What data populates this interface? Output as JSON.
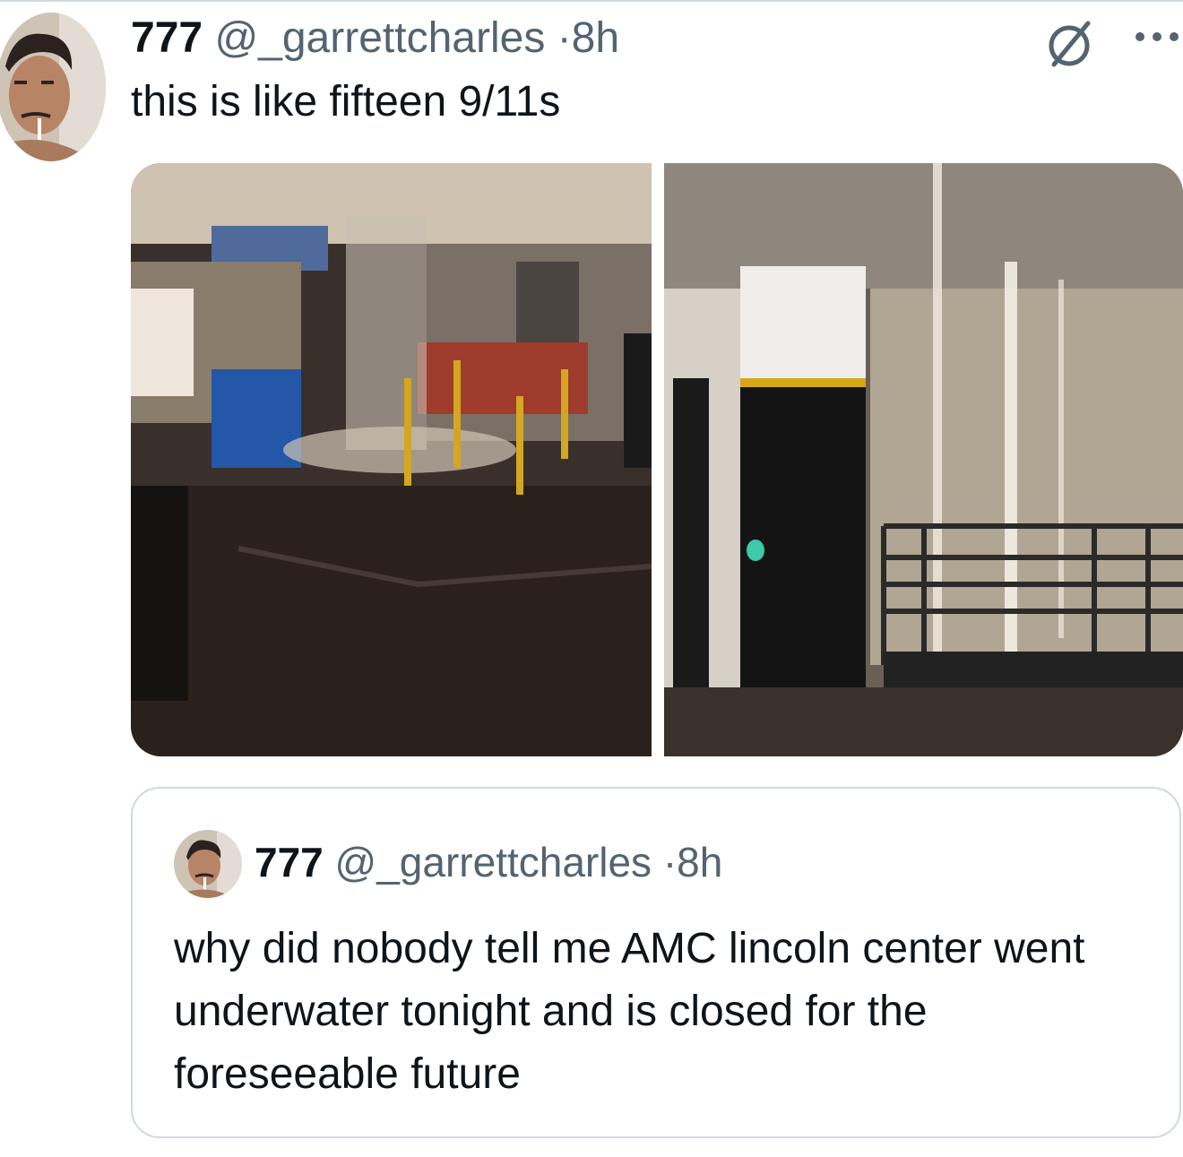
{
  "tweet": {
    "author_name": "777",
    "handle": "@_garrettcharles",
    "separator": "·",
    "time": "8h",
    "text": "this is like fifteen 9/11s",
    "icons": {
      "grok": "grok-slash-circle-icon",
      "more": "more-dots-icon"
    },
    "media": [
      {
        "description": "flooded theater lobby with concession stand and stanchions"
      },
      {
        "description": "water pouring from ceiling beside pillar and bench"
      }
    ]
  },
  "quoted_tweet": {
    "author_name": "777",
    "handle": "@_garrettcharles",
    "separator": "·",
    "time": "8h",
    "text": "why did nobody tell me AMC lincoln center went underwater tonight and is closed for the foreseeable future"
  },
  "colors": {
    "text_primary": "#0f1419",
    "text_secondary": "#536471",
    "border": "#cfd9de"
  }
}
